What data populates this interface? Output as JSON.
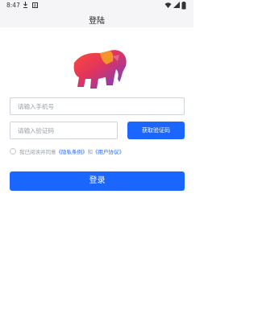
{
  "status_bar": {
    "time": "8:47",
    "icons": [
      "download-icon",
      "app-notification-icon",
      "wifi-icon",
      "signal-icon",
      "battery-icon"
    ]
  },
  "header": {
    "title": "登陆"
  },
  "form": {
    "phone_placeholder": "请输入手机号",
    "code_placeholder": "请输入验证码",
    "get_code_label": "获取验证码",
    "agreement": {
      "prefix": "我已阅读并同意",
      "privacy_link": "《隐私条例》",
      "and": "和",
      "user_link": "《用户协议》"
    },
    "login_label": "登录"
  },
  "colors": {
    "primary": "#1a66ff",
    "header_bg": "#f5f5f7"
  }
}
